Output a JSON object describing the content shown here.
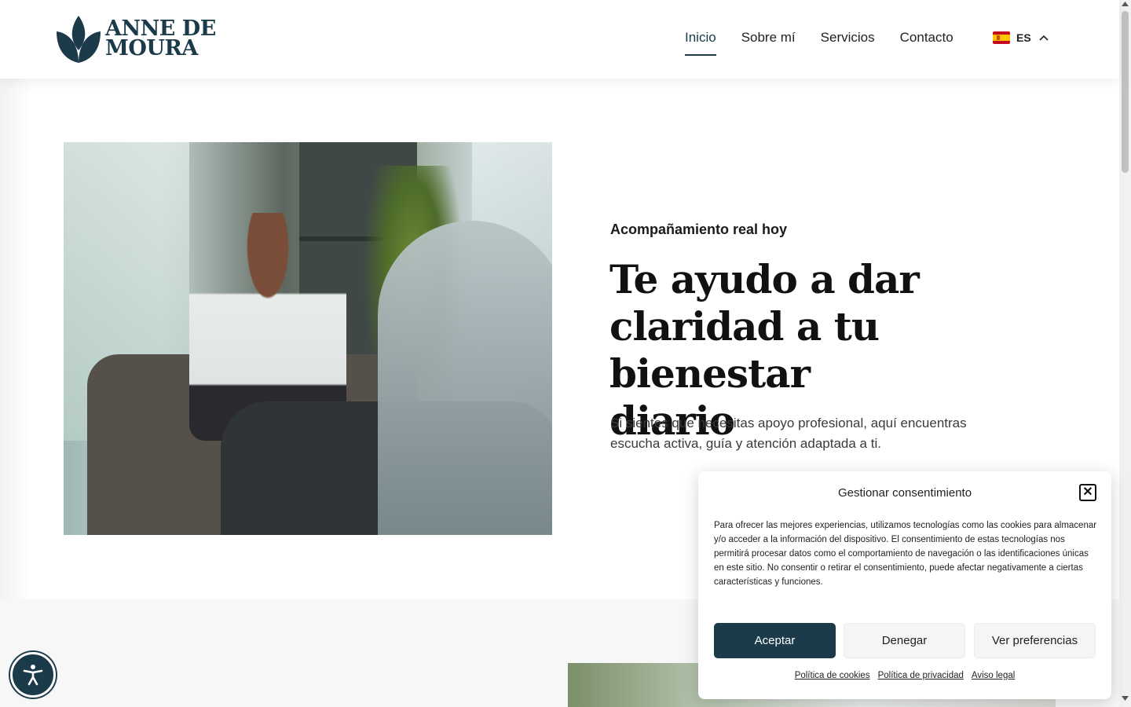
{
  "brand": {
    "line1": "ANNE DE",
    "line2": "MOURA",
    "color": "#1b3a4a"
  },
  "nav": {
    "items": [
      {
        "label": "Inicio",
        "active": true
      },
      {
        "label": "Sobre mí",
        "active": false
      },
      {
        "label": "Servicios",
        "active": false
      },
      {
        "label": "Contacto",
        "active": false
      }
    ],
    "language": {
      "code": "ES",
      "flag": "spain-flag-icon",
      "chevron": "chevron-up-icon"
    }
  },
  "hero": {
    "eyebrow": "Acompañamiento real hoy",
    "headline": "Te ayudo a dar claridad a tu bienestar diario",
    "subtext": "Si sientes que necesitas apoyo profesional, aquí encuentras escucha activa, guía y atención adaptada a ti."
  },
  "consent": {
    "title": "Gestionar consentimiento",
    "body": "Para ofrecer las mejores experiencias, utilizamos tecnologías como las cookies para almacenar y/o acceder a la información del dispositivo. El consentimiento de estas tecnologías nos permitirá procesar datos como el comportamiento de navegación o las identificaciones únicas en este sitio. No consentir o retirar el consentimiento, puede afectar negativamente a ciertas características y funciones.",
    "accept": "Aceptar",
    "deny": "Denegar",
    "preferences": "Ver preferencias",
    "links": {
      "cookies": "Política de cookies",
      "privacy": "Política de privacidad",
      "legal": "Aviso legal"
    },
    "close_icon": "close-icon"
  },
  "accessibility": {
    "icon": "accessibility-icon"
  }
}
